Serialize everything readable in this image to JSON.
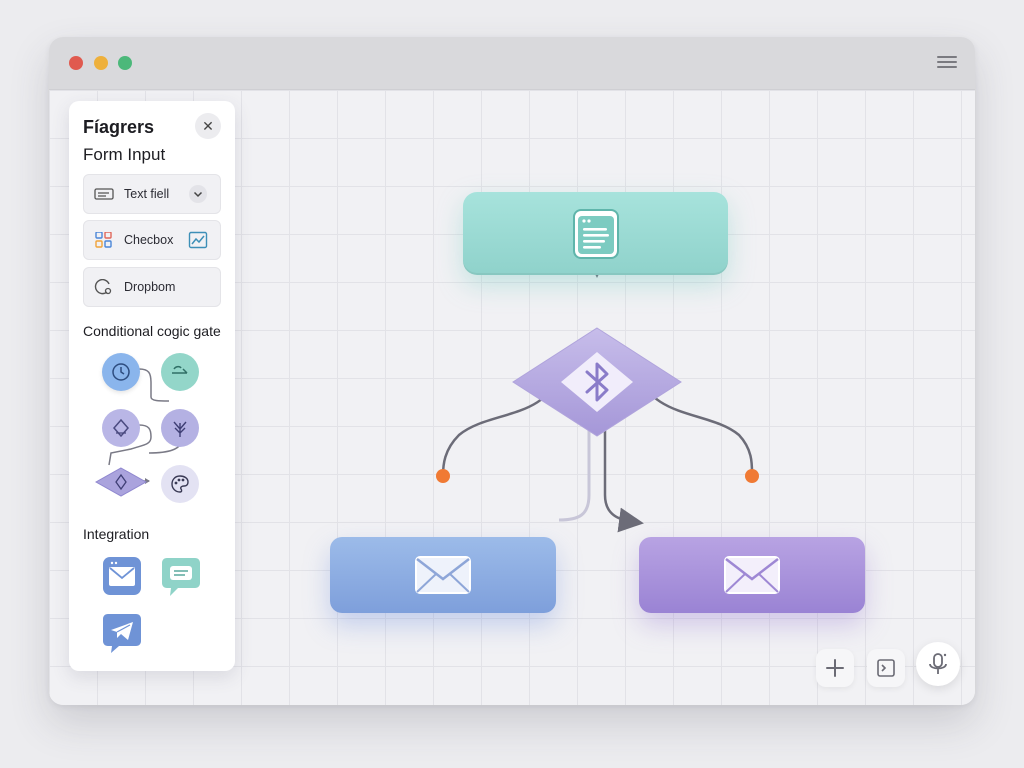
{
  "window": {
    "traffic_lights": [
      {
        "name": "close",
        "color": "#e05a4f"
      },
      {
        "name": "minimize",
        "color": "#eeb03c"
      },
      {
        "name": "maximize",
        "color": "#4cb87a"
      }
    ],
    "menu_icon": "hamburger-icon"
  },
  "panel": {
    "title": "Fíagrers",
    "close_icon": "close-icon",
    "form_input_title": "Form Input",
    "components": [
      {
        "label": "Text fiell",
        "icon": "text-field-icon",
        "trailing_icon": "chevron-down-icon"
      },
      {
        "label": "Checbox",
        "icon": "grid-icon",
        "trailing_icon": "chart-icon"
      },
      {
        "label": "Dropbom",
        "icon": "dropdown-icon"
      }
    ],
    "logic_title": "Conditional cogic gate",
    "integration_title": "Integration",
    "integrations": [
      {
        "icon": "mail-icon",
        "color": "#6f93d6"
      },
      {
        "icon": "chat-icon",
        "color": "#8fd3c8"
      },
      {
        "icon": "telegram-icon",
        "color": "#6f93d6"
      }
    ]
  },
  "flow": {
    "top_node_icon": "form-document-icon",
    "gate_icon": "bluetooth-icon",
    "left_node_icon": "envelope-icon",
    "right_node_icon": "envelope-icon",
    "colors": {
      "teal": "#93d6ce",
      "lavender": "#b3a6e0",
      "blue": "#8aaae0",
      "purple": "#a68ed9",
      "port_orange": "#f07a34"
    }
  },
  "canvas_tools": [
    {
      "name": "add",
      "icon": "plus-icon"
    },
    {
      "name": "console",
      "icon": "terminal-icon"
    },
    {
      "name": "voice",
      "icon": "microphone-icon"
    }
  ]
}
